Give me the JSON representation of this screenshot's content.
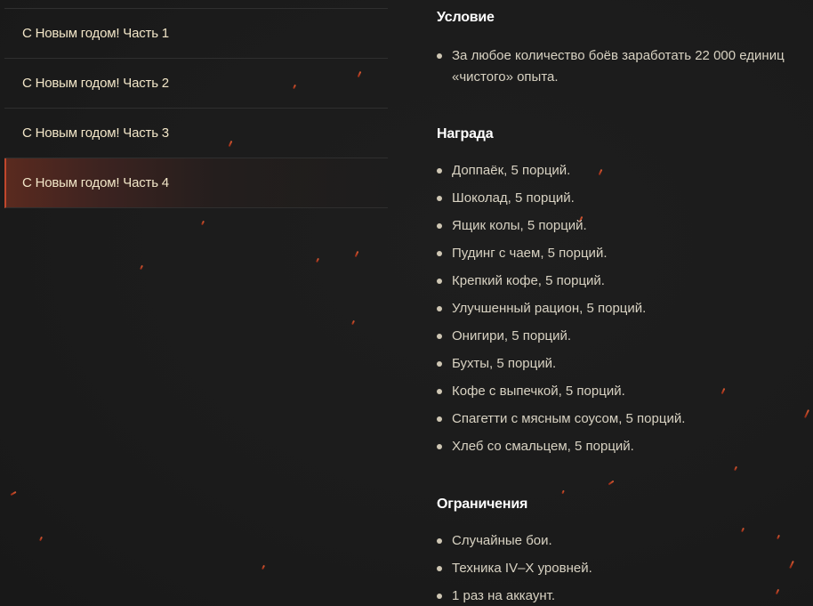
{
  "sidebar": {
    "items": [
      {
        "label": "С Новым годом! Часть 1"
      },
      {
        "label": "С Новым годом! Часть 2"
      },
      {
        "label": "С Новым годом! Часть 3"
      },
      {
        "label": "С Новым годом! Часть 4",
        "active": true
      }
    ]
  },
  "condition": {
    "title": "Условие",
    "items": [
      "За любое количество боёв заработать 22 000 единиц «чистого» опыта."
    ]
  },
  "reward": {
    "title": "Награда",
    "items": [
      "Доппаёк, 5 порций.",
      "Шоколад, 5 порций.",
      "Ящик колы, 5 порций.",
      "Пудинг с чаем, 5 порций.",
      "Крепкий кофе, 5 порций.",
      "Улучшенный рацион, 5 порций.",
      "Онигири, 5 порций.",
      "Бухты, 5 порций.",
      "Кофе с выпечкой, 5 порций.",
      "Спагетти с мясным соусом, 5 порций.",
      "Хлеб со смальцем, 5 порций."
    ]
  },
  "restrictions": {
    "title": "Ограничения",
    "items": [
      "Случайные бои.",
      "Техника IV–X уровней.",
      "1 раз на аккаунт."
    ]
  },
  "colors": {
    "background": "#1c1c1c",
    "accent": "#c0472c",
    "text": "#d8d2c2",
    "title": "#ffffff",
    "sidebar_text": "#f2e6c8"
  }
}
